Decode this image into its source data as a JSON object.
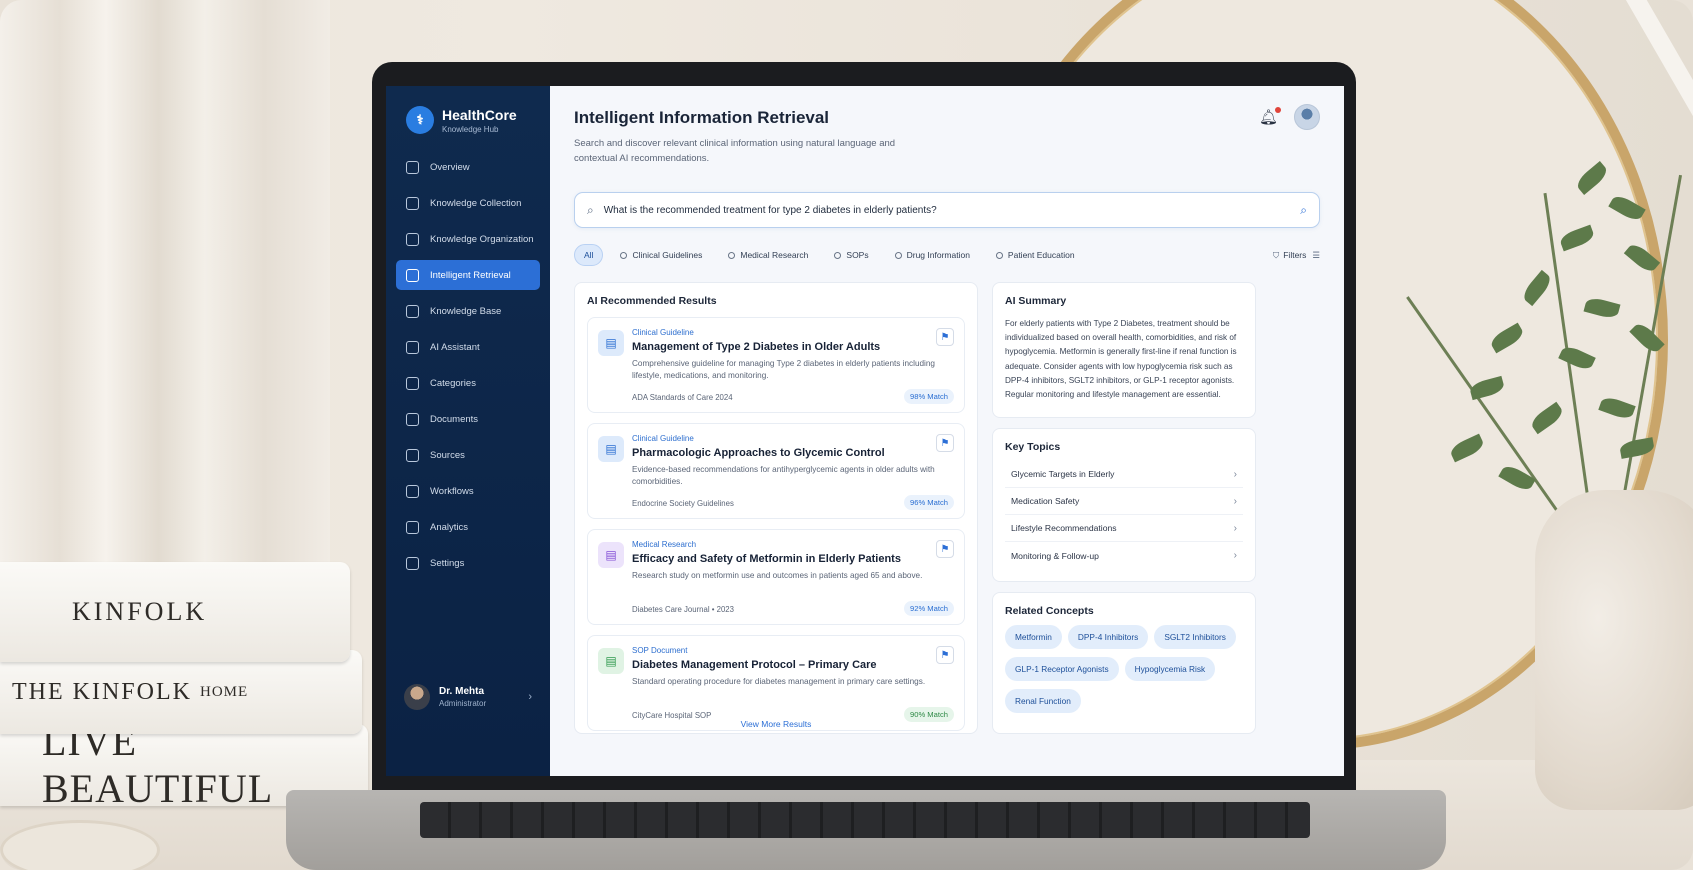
{
  "books": {
    "book1": "KINFOLK",
    "book2_a": "THE KINFOLK",
    "book2_b": "HOME",
    "book3": "LIVE BEAUTIFUL"
  },
  "brand": {
    "name": "HealthCore",
    "subtitle": "Knowledge Hub"
  },
  "sidebar": {
    "items": [
      {
        "label": "Overview",
        "icon": "home-icon"
      },
      {
        "label": "Knowledge Collection",
        "icon": "collection-icon"
      },
      {
        "label": "Knowledge Organization",
        "icon": "organization-icon"
      },
      {
        "label": "Intelligent Retrieval",
        "icon": "retrieval-icon",
        "active": true
      },
      {
        "label": "Knowledge Base",
        "icon": "database-icon"
      },
      {
        "label": "AI Assistant",
        "icon": "ai-icon"
      },
      {
        "label": "Categories",
        "icon": "categories-icon"
      },
      {
        "label": "Documents",
        "icon": "document-icon"
      },
      {
        "label": "Sources",
        "icon": "sources-icon"
      },
      {
        "label": "Workflows",
        "icon": "workflow-icon"
      },
      {
        "label": "Analytics",
        "icon": "analytics-icon"
      },
      {
        "label": "Settings",
        "icon": "gear-icon"
      }
    ],
    "user": {
      "name": "Dr. Mehta",
      "role": "Administrator"
    }
  },
  "header": {
    "title": "Intelligent Information Retrieval",
    "description": "Search and discover relevant clinical information using natural language and contextual AI recommendations."
  },
  "search": {
    "value": "What is the recommended treatment for type 2 diabetes in elderly patients?"
  },
  "filters": {
    "chips": [
      "All",
      "Clinical Guidelines",
      "Medical Research",
      "SOPs",
      "Drug Information",
      "Patient Education"
    ],
    "button_label": "Filters"
  },
  "results": {
    "title": "AI Recommended Results",
    "items": [
      {
        "type": "Clinical Guideline",
        "title": "Management of Type 2 Diabetes in Older Adults",
        "description": "Comprehensive guideline for managing Type 2 diabetes in elderly patients including lifestyle, medications, and monitoring.",
        "source": "ADA Standards of Care 2024",
        "match": "98% Match"
      },
      {
        "type": "Clinical Guideline",
        "title": "Pharmacologic Approaches to Glycemic Control",
        "description": "Evidence-based recommendations for antihyperglycemic agents in older adults with comorbidities.",
        "source": "Endocrine Society Guidelines",
        "match": "96% Match"
      },
      {
        "type": "Medical Research",
        "title": "Efficacy and Safety of Metformin in Elderly Patients",
        "description": "Research study on metformin use and outcomes in patients aged 65 and above.",
        "source": "Diabetes Care Journal  •  2023",
        "match": "92% Match"
      },
      {
        "type": "SOP Document",
        "title": "Diabetes Management Protocol – Primary Care",
        "description": "Standard operating procedure for diabetes management in primary care settings.",
        "source": "CityCare Hospital SOP",
        "match": "90% Match"
      }
    ],
    "view_more": "View More Results"
  },
  "summary": {
    "title": "AI Summary",
    "text": "For elderly patients with Type 2 Diabetes, treatment should be individualized based on overall health, comorbidities, and risk of hypoglycemia. Metformin is generally first-line if renal function is adequate. Consider agents with low hypoglycemia risk such as DPP-4 inhibitors, SGLT2 inhibitors, or GLP-1 receptor agonists. Regular monitoring and lifestyle management are essential."
  },
  "key_topics": {
    "title": "Key Topics",
    "items": [
      "Glycemic Targets in Elderly",
      "Medication Safety",
      "Lifestyle Recommendations",
      "Monitoring & Follow-up"
    ]
  },
  "related_concepts": {
    "title": "Related Concepts",
    "items": [
      "Metformin",
      "DPP-4 Inhibitors",
      "SGLT2 Inhibitors",
      "GLP-1 Receptor Agonists",
      "Hypoglycemia Risk",
      "Renal Function"
    ]
  },
  "colors": {
    "sidebar": "#0f2a4e",
    "accent": "#2c6fd6",
    "match_green": "#2f8a47"
  }
}
